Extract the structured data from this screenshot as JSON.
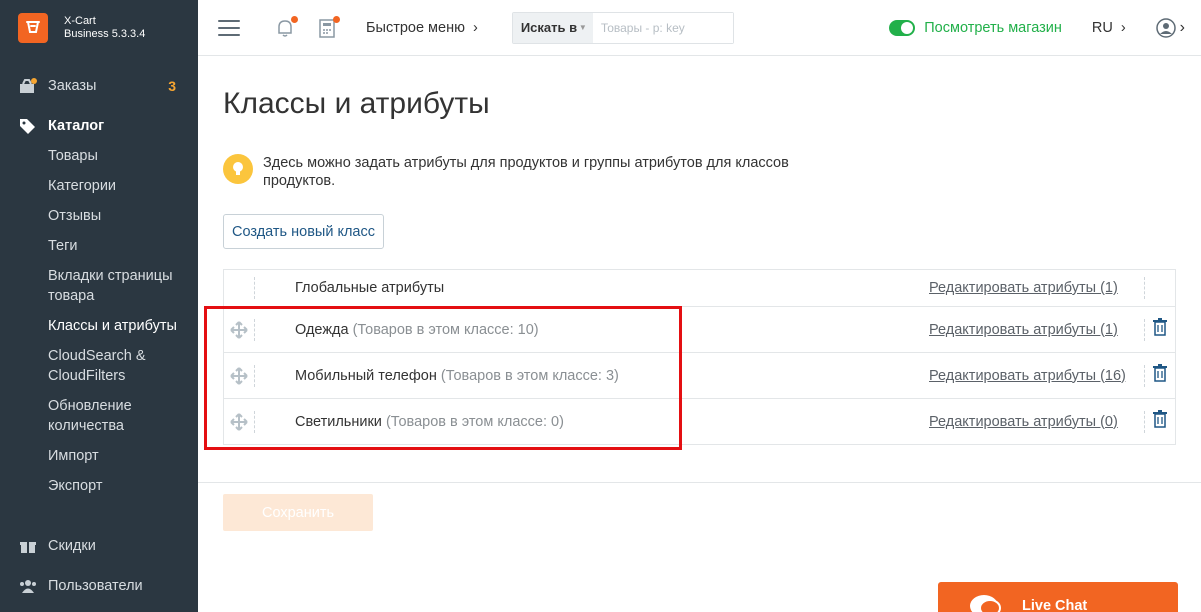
{
  "brand": {
    "name": "X-Cart",
    "edition": "Business 5.3.3.4"
  },
  "sidebar": {
    "items": [
      {
        "label": "Заказы",
        "icon": "orders-icon",
        "count": "3"
      },
      {
        "label": "Каталог",
        "icon": "tag-icon",
        "active": true
      },
      {
        "label": "Скидки",
        "icon": "gift-icon"
      },
      {
        "label": "Пользователи",
        "icon": "users-icon"
      }
    ],
    "catalog_sub": [
      {
        "label": "Товары"
      },
      {
        "label": "Категории"
      },
      {
        "label": "Отзывы"
      },
      {
        "label": "Теги"
      },
      {
        "label": "Вкладки страницы товара"
      },
      {
        "label": "Классы и атрибуты",
        "current": true
      },
      {
        "label": "CloudSearch & CloudFilters"
      },
      {
        "label": "Обновление количества"
      },
      {
        "label": "Импорт"
      },
      {
        "label": "Экспорт"
      }
    ]
  },
  "header": {
    "quick_menu": "Быстрое меню",
    "search_select": "Искать в",
    "search_placeholder": "Товары - p: key",
    "view_store": "Посмотреть магазин",
    "lang": "RU"
  },
  "page": {
    "title": "Классы и атрибуты",
    "tip": "Здесь можно задать атрибуты для продуктов и группы атрибутов для классов продуктов.",
    "create_button": "Создать новый класс",
    "save_button": "Сохранить"
  },
  "rows": [
    {
      "name": "Глобальные атрибуты",
      "count": "",
      "edit": "Редактировать атрибуты (1)"
    },
    {
      "name": "Одежда",
      "count": "(Товаров в этом классе: 10)",
      "edit": "Редактировать атрибуты (1)"
    },
    {
      "name": "Мобильный телефон",
      "count": "(Товаров в этом классе: 3)",
      "edit": "Редактировать атрибуты (16)"
    },
    {
      "name": "Светильники",
      "count": "(Товаров в этом классе: 0)",
      "edit": "Редактировать атрибуты (0)"
    }
  ],
  "livechat": {
    "label": "Live Chat"
  },
  "colors": {
    "sidebar_bg": "#2b3741",
    "accent": "#f26522",
    "toggle_green": "#22b04a",
    "highlight": "#e40f12"
  }
}
